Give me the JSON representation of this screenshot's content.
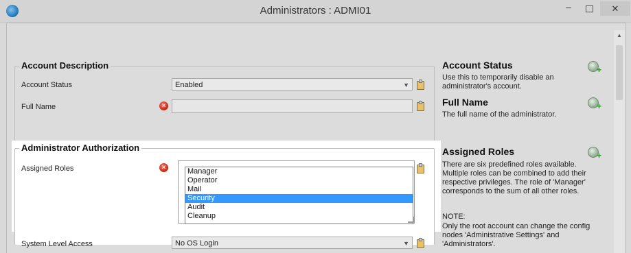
{
  "window": {
    "title": "Administrators : ADMI01",
    "minimize_glyph": "–",
    "close_glyph": "✕"
  },
  "account_description": {
    "group_title": "Account Description",
    "account_status_label": "Account Status",
    "account_status_value": "Enabled",
    "full_name_label": "Full Name",
    "full_name_value": ""
  },
  "administrator_authorization": {
    "group_title": "Administrator Authorization",
    "assigned_roles_label": "Assigned Roles",
    "roles": [
      "Manager",
      "Operator",
      "Mail",
      "Security",
      "Audit",
      "Cleanup"
    ],
    "selected_role": "Security",
    "system_level_access_label": "System Level Access",
    "system_level_access_value": "No OS Login"
  },
  "help": {
    "account_status_title": "Account Status",
    "account_status_text": "Use this to temporarily disable an administrator's account.",
    "full_name_title": "Full Name",
    "full_name_text": "The full name of the administrator.",
    "assigned_roles_title": "Assigned Roles",
    "assigned_roles_text": "There are six predefined roles available. Multiple roles can be combined to add their respective privileges. The role of 'Manager' corresponds to the sum of all other roles.",
    "note_label": "NOTE:",
    "note_text": "Only the root account can change the config nodes 'Administrative Settings' and 'Administrators'."
  },
  "icons": {
    "dropdown_arrow": "chevron-down-icon",
    "error": "error-x-icon",
    "clipboard": "clipboard-icon",
    "add_comment": "add-comment-icon"
  },
  "colors": {
    "selection": "#3399ff",
    "error": "#c4230f",
    "add": "#2a9a2a"
  }
}
